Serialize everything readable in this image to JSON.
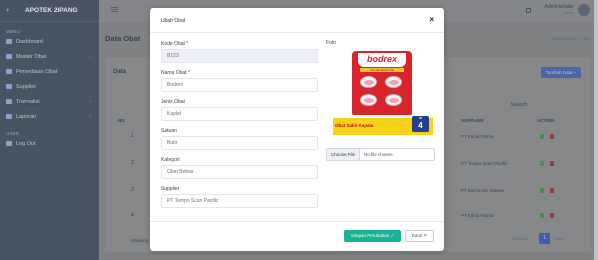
{
  "app": {
    "brand": "APOTEK 2IPANG",
    "logo_text": "+"
  },
  "sidebar": {
    "section_menu": "MENU",
    "items": [
      {
        "label": "Dashboard"
      },
      {
        "label": "Master Obat",
        "chevron": "›"
      },
      {
        "label": "Persediaan Obat"
      },
      {
        "label": "Supplier"
      },
      {
        "label": "Transaksi",
        "chevron": "›"
      },
      {
        "label": "Laporan",
        "chevron": "›"
      }
    ],
    "section_user": "USER",
    "logout": "Log Out"
  },
  "topbar": {
    "user_name": "Administrator",
    "user_role": "Admin"
  },
  "page": {
    "title": "Data Obat",
    "breadcrumb": "Master Obat  /  Obat"
  },
  "card": {
    "title": "Data",
    "button": "Tambah Data +",
    "show_label": "Show",
    "search_label": "Search:",
    "columns": [
      "NO",
      "SUPPLIER",
      "ACTION"
    ],
    "rows": [
      {
        "no": "1",
        "supplier": "PT Kimia Farma"
      },
      {
        "no": "2",
        "supplier": "PT Tempo Scan Pacific"
      },
      {
        "no": "3",
        "supplier": "PT Merck AIK Sukses"
      },
      {
        "no": "4",
        "supplier": "PT Kimia Farma"
      }
    ],
    "showing": "Showing 1",
    "page": "1",
    "prev": "Previous",
    "next": "Next"
  },
  "modal": {
    "title": "Ubah Obat",
    "close": "×",
    "fields": {
      "kode_label": "Kode Obat *",
      "kode_value": "B123",
      "nama_label": "Nama Obat *",
      "nama_value": "Bodrex",
      "jenis_label": "Jenis Obat",
      "jenis_value": "Kaplet",
      "satuan_label": "Satuan",
      "satuan_value": "Butir",
      "kategori_label": "Kategori",
      "kategori_value": "Obat Bebas",
      "supplier_label": "Supplier",
      "supplier_value": "PT Tempo Scan Pacific"
    },
    "foto_label": "Foto",
    "product": {
      "brand": "bodrex",
      "tagline": "Flu dan Batuk PE",
      "band_text": "Obat Sakit Kepala",
      "isi_label": "isi",
      "count": "4"
    },
    "file": {
      "button": "Choose File",
      "name": "No file chosen"
    },
    "save_button": "Simpan Perubahan ✓",
    "cancel_button": "Batal ✕"
  }
}
